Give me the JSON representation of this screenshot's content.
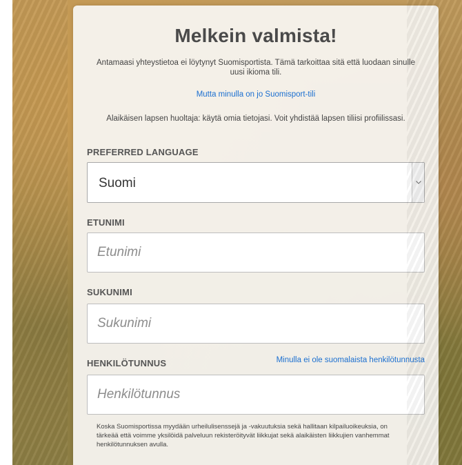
{
  "form": {
    "title": "Melkein valmista!",
    "intro": "Antamaasi yhteystietoa ei löytynyt Suomisportista. Tämä tarkoittaa sitä että luodaan sinulle uusi ikioma tili.",
    "existing_account_link": "Mutta minulla on jo Suomisport-tili",
    "guardian_note": "Alaikäisen lapsen huoltaja: käytä omia tietojasi. Voit yhdistää lapsen tiliisi profiilissasi.",
    "language": {
      "label": "PREFERRED LANGUAGE",
      "selected": "Suomi",
      "arrow_icon": "chevron-down-icon"
    },
    "first_name": {
      "label": "ETUNIMI",
      "value": "",
      "placeholder": "Etunimi"
    },
    "last_name": {
      "label": "SUKUNIMI",
      "value": "",
      "placeholder": "Sukunimi"
    },
    "ssn": {
      "label": "HENKILÖTUNNUS",
      "value": "",
      "placeholder": "Henkilötunnus",
      "no_ssn_link": "Minulla ei ole suomalaista henkilötunnusta"
    },
    "notice": "Koska Suomisportissa myydään urheilulisenssejä ja -vakuutuksia sekä hallitaan kilpailuoikeuksia, on tärkeää että voimme yksilöidä palveluun rekisteröityvät liikkujat sekä alaikäisten liikkujien vanhemmat henkilötunnuksen avulla."
  },
  "colors": {
    "link": "#1b6fd0",
    "title": "#4a4a4a",
    "card_background": "#f7f4f0"
  }
}
